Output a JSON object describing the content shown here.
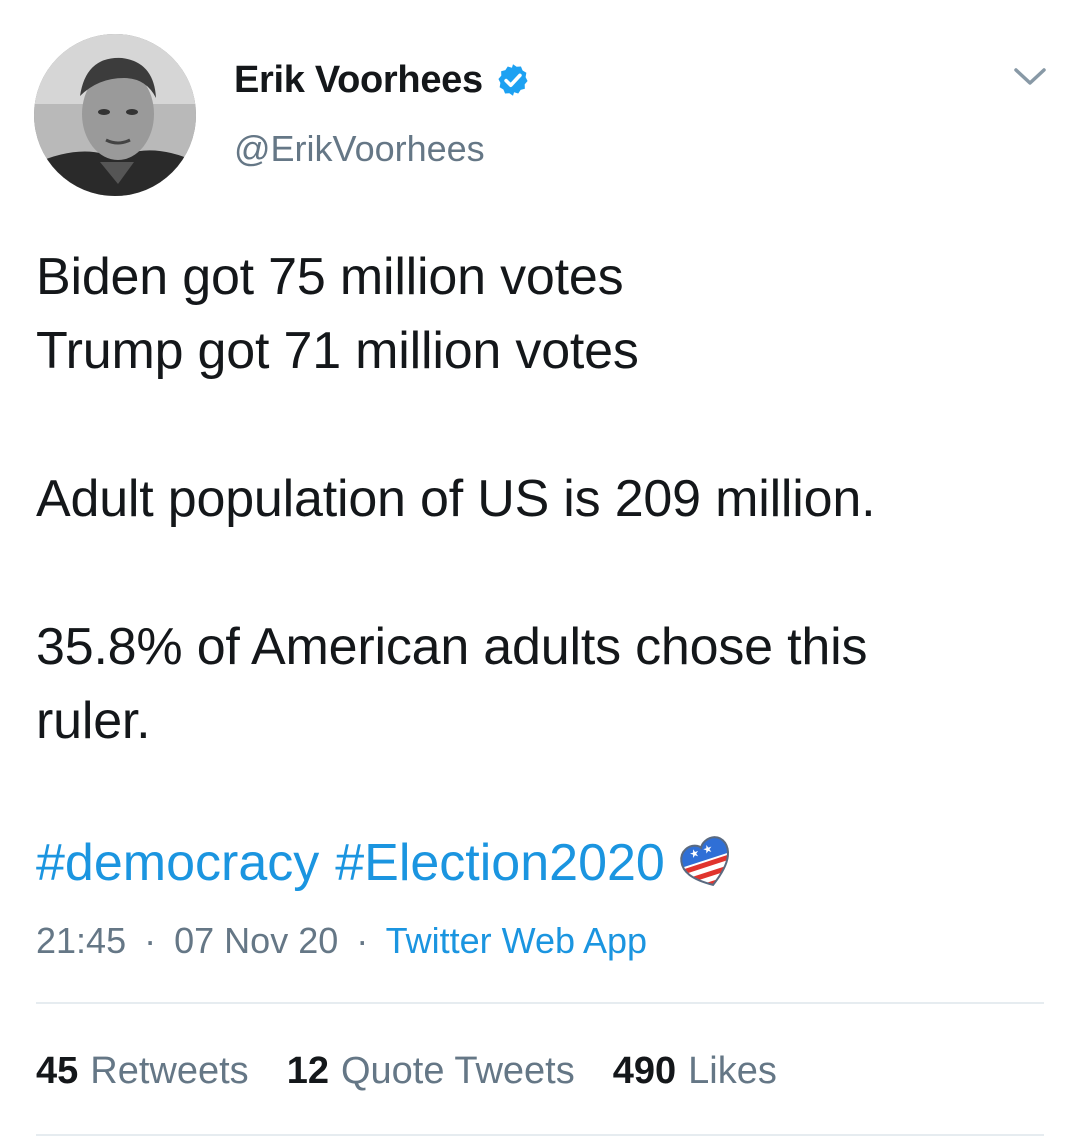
{
  "user": {
    "display_name": "Erik Voorhees",
    "handle": "@ErikVoorhees",
    "verified": true,
    "avatar": "profile-photo"
  },
  "menu": {
    "icon": "chevron-down-icon"
  },
  "tweet": {
    "lines": [
      "Biden got 75 million votes",
      "Trump got 71 million votes",
      "Adult population of US is 209 million.",
      "35.8% of American adults chose this",
      "ruler."
    ],
    "hashtags": [
      "#democracy",
      "#Election2020"
    ],
    "hashtag_emoji": "election-heart-emoji"
  },
  "meta": {
    "time": "21:45",
    "separator": "·",
    "date": "07 Nov 20",
    "source": "Twitter Web App"
  },
  "stats": {
    "retweets_count": "45",
    "retweets_label": "Retweets",
    "quotes_count": "12",
    "quotes_label": "Quote Tweets",
    "likes_count": "490",
    "likes_label": "Likes"
  },
  "colors": {
    "link": "#1b95e0",
    "secondary_text": "#657786",
    "primary_text": "#14171a",
    "verified_badge": "#1da1f2",
    "divider": "#e6ecf0"
  }
}
